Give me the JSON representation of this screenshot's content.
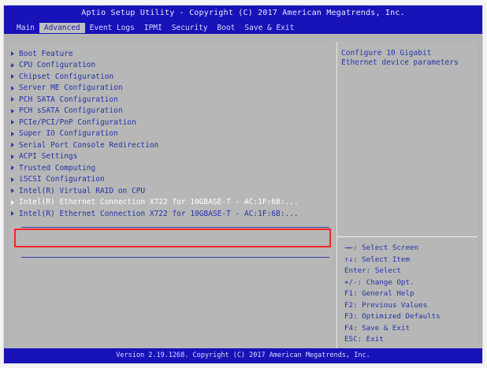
{
  "title": "Aptio Setup Utility - Copyright (C) 2017 American Megatrends, Inc.",
  "tabs": [
    {
      "label": "Main"
    },
    {
      "label": "Advanced"
    },
    {
      "label": "Event Logs"
    },
    {
      "label": "IPMI"
    },
    {
      "label": "Security"
    },
    {
      "label": "Boot"
    },
    {
      "label": "Save & Exit"
    }
  ],
  "menu": [
    {
      "label": "Boot Feature"
    },
    {
      "label": "CPU Configuration"
    },
    {
      "label": "Chipset Configuration"
    },
    {
      "label": "Server ME Configuration"
    },
    {
      "label": "PCH SATA Configuration"
    },
    {
      "label": "PCH sSATA Configuration"
    },
    {
      "label": "PCIe/PCI/PnP Configuration"
    },
    {
      "label": "Super IO Configuration"
    },
    {
      "label": "Serial Port Console Redirection"
    },
    {
      "label": "ACPI Settings"
    },
    {
      "label": "Trusted Computing"
    },
    {
      "label": "iSCSI Configuration"
    },
    {
      "label": "Intel(R) Virtual RAID on CPU"
    },
    {
      "label": "Intel(R) Ethernet Connection X722 for 10GBASE-T - AC:1F:6B:..."
    },
    {
      "label": "Intel(R) Ethernet Connection X722 for 10GBASE-T - AC:1F:6B:..."
    }
  ],
  "help": {
    "description": "Configure 10 Gigabit\nEthernet device parameters"
  },
  "keys": [
    {
      "text": "→←: Select Screen"
    },
    {
      "text": "↑↓: Select Item"
    },
    {
      "text": "Enter: Select"
    },
    {
      "text": "+/-: Change Opt."
    },
    {
      "text": "F1: General Help"
    },
    {
      "text": "F2: Previous Values"
    },
    {
      "text": "F3: Optimized Defaults"
    },
    {
      "text": "F4: Save & Exit"
    },
    {
      "text": "ESC: Exit"
    }
  ],
  "footer": "Version 2.19.1268. Copyright (C) 2017 American Megatrends, Inc.",
  "colors": {
    "bar_blue": "#1713b8",
    "panel_gray": "#b7b7b7",
    "text_blue": "#2333a8",
    "highlight_red": "#f32727"
  }
}
